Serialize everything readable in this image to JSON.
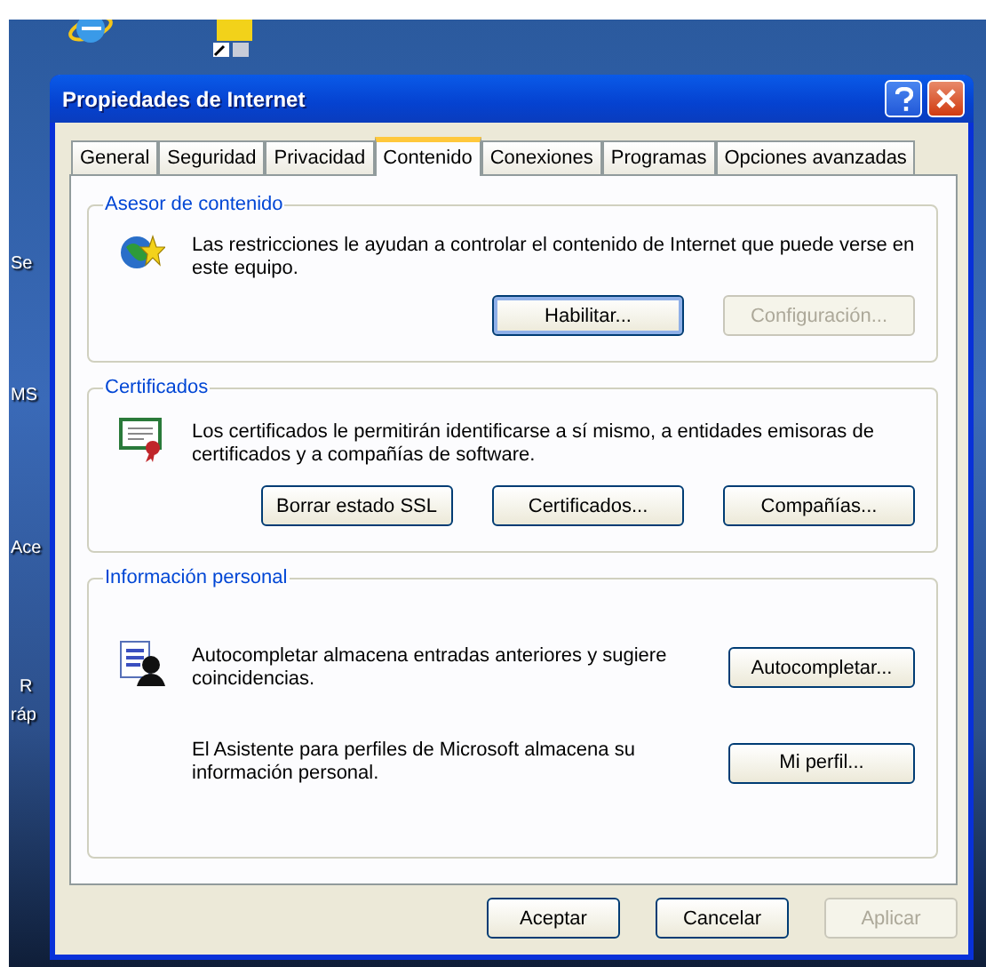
{
  "desktop": {
    "labels": [
      {
        "text": "Se"
      },
      {
        "text": "MS"
      },
      {
        "text": "Ace"
      },
      {
        "text": "R"
      },
      {
        "text": "ráp"
      }
    ]
  },
  "window": {
    "title": "Propiedades de Internet"
  },
  "tabs": [
    {
      "label": "General",
      "selected": false
    },
    {
      "label": "Seguridad",
      "selected": false
    },
    {
      "label": "Privacidad",
      "selected": false
    },
    {
      "label": "Contenido",
      "selected": true
    },
    {
      "label": "Conexiones",
      "selected": false
    },
    {
      "label": "Programas",
      "selected": false
    },
    {
      "label": "Opciones avanzadas",
      "selected": false
    }
  ],
  "groups": [
    {
      "title": "Asesor de contenido",
      "rows": [
        {
          "text": "Las restricciones le ayudan a controlar el contenido de Internet que puede verse en este equipo.",
          "buttons": [
            {
              "label": "Habilitar...",
              "default": true,
              "disabled": false
            },
            {
              "label": "Configuración...",
              "default": false,
              "disabled": true
            }
          ]
        }
      ]
    },
    {
      "title": "Certificados",
      "rows": [
        {
          "text": "Los certificados le permitirán identificarse a sí mismo, a entidades emisoras de certificados y a compañías de software.",
          "buttons": [
            {
              "label": "Borrar estado SSL",
              "default": false,
              "disabled": false
            },
            {
              "label": "Certificados...",
              "default": false,
              "disabled": false
            },
            {
              "label": "Compañías...",
              "default": false,
              "disabled": false
            }
          ]
        }
      ]
    },
    {
      "title": "Información personal",
      "rows": [
        {
          "text": "Autocompletar almacena entradas anteriores y sugiere coincidencias.",
          "side_button": {
            "label": "Autocompletar...",
            "default": false,
            "disabled": false
          }
        },
        {
          "text": "El Asistente para perfiles de Microsoft almacena su información personal.",
          "side_button": {
            "label": "Mi perfil...",
            "default": false,
            "disabled": false
          }
        }
      ]
    }
  ],
  "footer_buttons": [
    {
      "label": "Aceptar",
      "default": false,
      "disabled": false
    },
    {
      "label": "Cancelar",
      "default": false,
      "disabled": false
    },
    {
      "label": "Aplicar",
      "default": false,
      "disabled": true
    }
  ]
}
